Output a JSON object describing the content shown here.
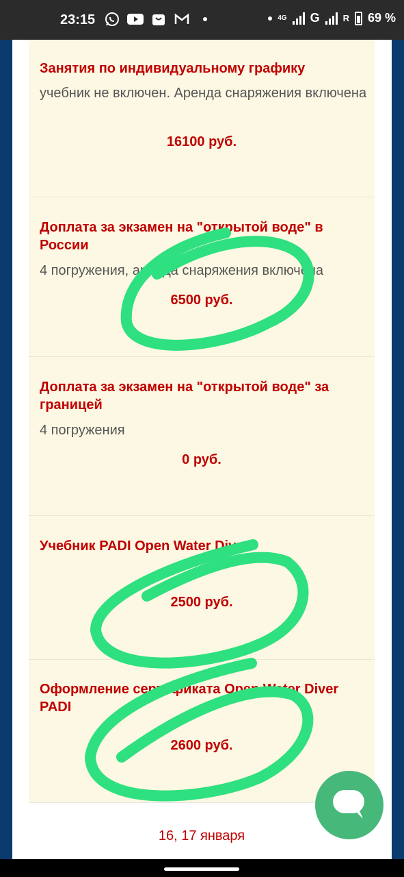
{
  "status_bar": {
    "time": "23:15",
    "network_label": "4G",
    "carrier_g": "G",
    "roaming": "R",
    "battery": "69 %",
    "icons": [
      "whatsapp-icon",
      "youtube-icon",
      "store-icon",
      "gmail-icon"
    ]
  },
  "items": [
    {
      "title": "Занятия по индивидуальному графику",
      "desc": "учебник не включен. Аренда снаряжения включена",
      "price": "16100 руб."
    },
    {
      "title": "Доплата за экзамен на \"открытой воде\" в России",
      "desc": "4 погружения, аренда снаряжения включена",
      "price": "6500 руб."
    },
    {
      "title": "Доплата за экзамен на \"открытой воде\" за границей",
      "desc": "4 погружения",
      "price": "0 руб."
    },
    {
      "title": "Учебник PADI Open Water Diver",
      "desc": "",
      "price": "2500 руб."
    },
    {
      "title": "Оформление сертификата Open Water Diver PADI",
      "desc": "",
      "price": "2600 руб."
    }
  ],
  "date_row": {
    "label": "16, 17 января"
  },
  "colors": {
    "accent_red": "#c00000",
    "card_bg": "#fcf8e3",
    "frame_blue": "#0b3a6e",
    "chat_green": "#45b87a",
    "marker_green": "#2ee07f"
  }
}
